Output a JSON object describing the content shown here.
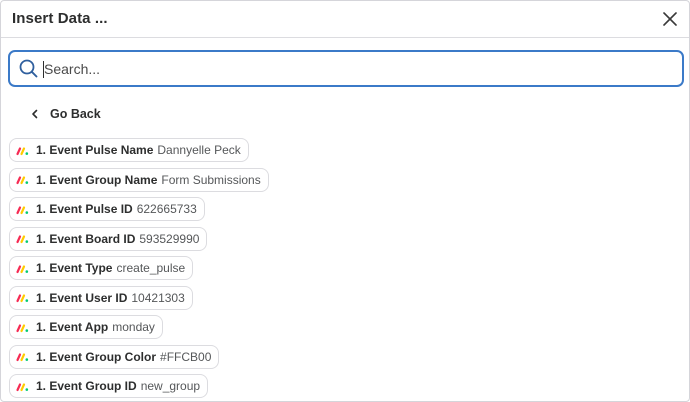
{
  "dialog": {
    "title": "Insert Data ...",
    "close_icon": "close-icon"
  },
  "search": {
    "placeholder": "Search...",
    "value": "",
    "icon": "search-icon",
    "accent_color": "#3b7ac8"
  },
  "nav": {
    "back_label": "Go Back",
    "back_icon": "chevron-left-icon"
  },
  "items": [
    {
      "label": "1. Event Pulse Name",
      "value": "Dannyelle Peck",
      "icon": "monday-app-icon"
    },
    {
      "label": "1. Event Group Name",
      "value": "Form Submissions",
      "icon": "monday-app-icon"
    },
    {
      "label": "1. Event Pulse ID",
      "value": "622665733",
      "icon": "monday-app-icon"
    },
    {
      "label": "1. Event Board ID",
      "value": "593529990",
      "icon": "monday-app-icon"
    },
    {
      "label": "1. Event Type",
      "value": "create_pulse",
      "icon": "monday-app-icon"
    },
    {
      "label": "1. Event User ID",
      "value": "10421303",
      "icon": "monday-app-icon"
    },
    {
      "label": "1. Event App",
      "value": "monday",
      "icon": "monday-app-icon"
    },
    {
      "label": "1. Event Group Color",
      "value": "#FFCB00",
      "icon": "monday-app-icon"
    },
    {
      "label": "1. Event Group ID",
      "value": "new_group",
      "icon": "monday-app-icon"
    }
  ]
}
